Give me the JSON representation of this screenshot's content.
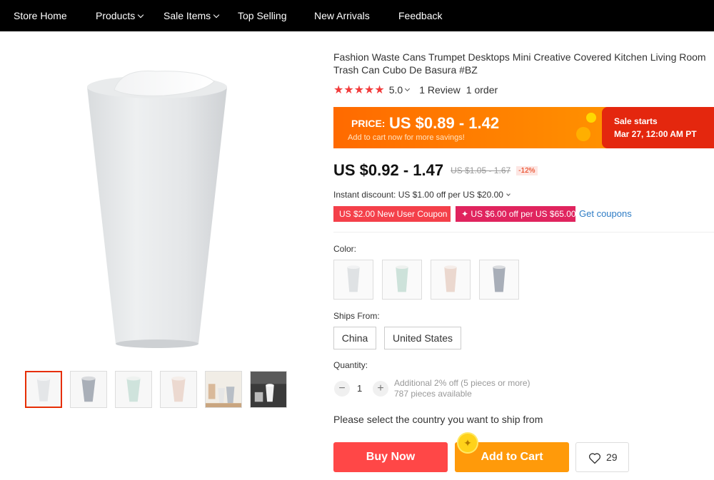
{
  "nav": {
    "items": [
      {
        "label": "Store Home",
        "has_dropdown": false
      },
      {
        "label": "Products",
        "has_dropdown": true
      },
      {
        "label": "Sale Items",
        "has_dropdown": true
      },
      {
        "label": "Top Selling",
        "has_dropdown": false
      },
      {
        "label": "New Arrivals",
        "has_dropdown": false
      },
      {
        "label": "Feedback",
        "has_dropdown": false
      }
    ]
  },
  "product": {
    "title": "Fashion Waste Cans Trumpet Desktops Mini Creative Covered Kitchen Living Room Trash Can Cubo De Basura #BZ",
    "stars": "★★★★★",
    "rating": "5.0",
    "reviews": "1 Review",
    "orders": "1 order"
  },
  "promo": {
    "price_label": "PRICE:",
    "price_value": "US $0.89 - 1.42",
    "hint": "Add to cart now for more savings!",
    "sale_title": "Sale starts",
    "sale_date": "Mar 27, 12:00 AM PT"
  },
  "pricing": {
    "current": "US $0.92 - 1.47",
    "original": "US $1.05 - 1.67",
    "discount": "-12%",
    "instant_discount": "Instant discount: US $1.00 off per US $20.00"
  },
  "coupons": {
    "new_user": "US $2.00 New User Coupon",
    "store": "✦ US $6.00 off per US $65.00",
    "get_link": "Get coupons"
  },
  "options": {
    "color_label": "Color:",
    "colors": [
      "white",
      "mint-green",
      "pink",
      "gray"
    ],
    "ships_from_label": "Ships From:",
    "ships_from": [
      "China",
      "United States"
    ]
  },
  "quantity": {
    "label": "Quantity:",
    "value": "1",
    "minus": "−",
    "plus": "+",
    "bulk_note": "Additional 2% off (5 pieces or more)",
    "available": "787 pieces available"
  },
  "shipping_message": "Please select the country you want to ship from",
  "actions": {
    "buy_now": "Buy Now",
    "add_to_cart": "Add to Cart",
    "wishlist_count": "29"
  },
  "colors": {
    "accent_red": "#ff4747",
    "accent_orange": "#ff9a0a",
    "link_blue": "#2e7cc5"
  }
}
